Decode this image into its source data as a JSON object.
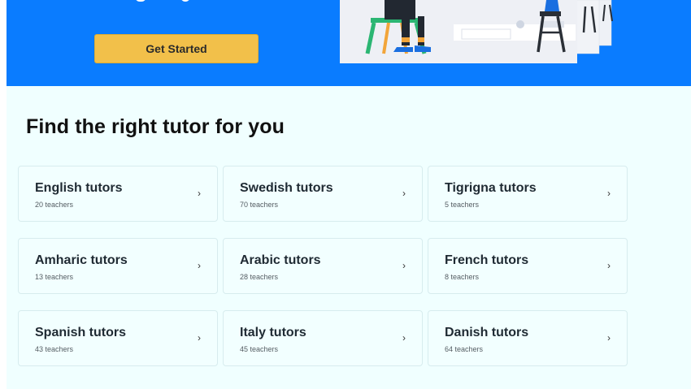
{
  "hero": {
    "cta_label": "Get Started"
  },
  "section": {
    "title": "Find the right tutor for you"
  },
  "tutors": [
    {
      "label": "English tutors",
      "count": "20 teachers"
    },
    {
      "label": "Swedish tutors",
      "count": "70 teachers"
    },
    {
      "label": "Tigrigna tutors",
      "count": "5 teachers"
    },
    {
      "label": "Amharic tutors",
      "count": "13 teachers"
    },
    {
      "label": "Arabic tutors",
      "count": "28 teachers"
    },
    {
      "label": "French tutors",
      "count": "8 teachers"
    },
    {
      "label": "Spanish tutors",
      "count": "43 teachers"
    },
    {
      "label": "Italy tutors",
      "count": "45 teachers"
    },
    {
      "label": "Danish tutors",
      "count": "64 teachers"
    }
  ],
  "icons": {
    "card_arrow": "chevron-right-icon",
    "chevron_glyph": "›"
  },
  "colors": {
    "hero_bg": "#0a7cff",
    "cta_bg": "#f2c04a",
    "section_bg": "#f0ffff"
  }
}
